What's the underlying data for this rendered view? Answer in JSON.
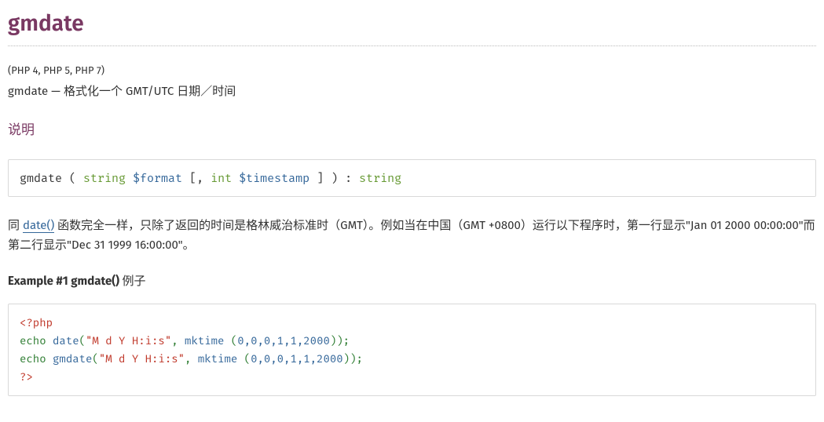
{
  "title": "gmdate",
  "verinfo": "(PHP 4, PHP 5, PHP 7)",
  "refpurpose": "gmdate — 格式化一个 GMT/UTC 日期／时间",
  "section_desc_title": "说明",
  "synopsis": {
    "name": "gmdate",
    "open": " ( ",
    "type1": "string",
    "param1": " $format",
    "sep": " [, ",
    "type2": "int",
    "param2": " $timestamp",
    "close": " ] ) : ",
    "ret": "string"
  },
  "para_before_link": "同 ",
  "link_text": "date()",
  "para_after_link": " 函数完全一样，只除了返回的时间是格林威治标准时（GMT）。例如当在中国（GMT +0800）运行以下程序时，第一行显示\"Jan 01 2000 00:00:00\"而第二行显示\"Dec 31 1999 16:00:00\"。",
  "example_label": "Example #1 gmdate() ",
  "example_suffix": "例子",
  "code": {
    "open_tag": "<?php",
    "l1_kw": "echo",
    "l1_fn": "date",
    "l1_str": "\"M d Y H:i:s\"",
    "l1_comma": ", ",
    "l1_fn2": "mktime",
    "l1_args": "0,0,0,1,1,2000",
    "l2_kw": "echo",
    "l2_fn": "gmdate",
    "l2_str": "\"M d Y H:i:s\"",
    "l2_comma": ", ",
    "l2_fn2": "mktime",
    "l2_args": "0,0,0,1,1,2000",
    "close_tag": "?>"
  }
}
